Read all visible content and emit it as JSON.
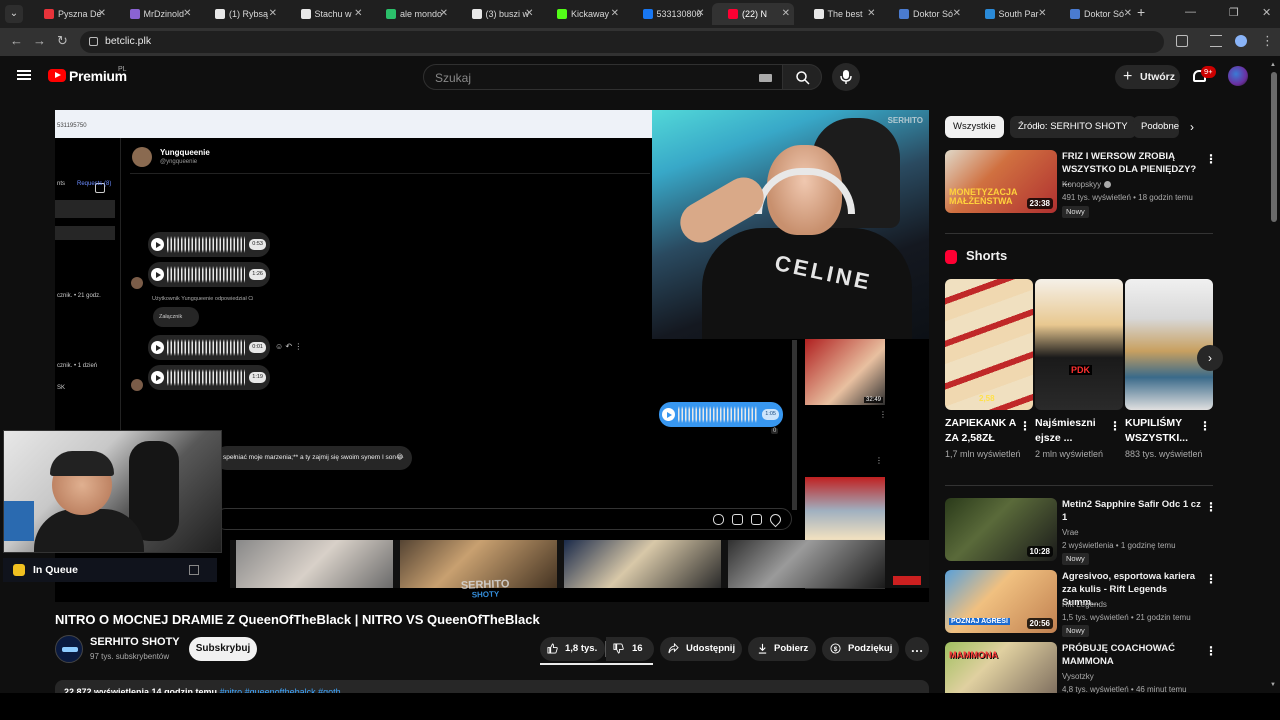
{
  "browser": {
    "tabs": [
      {
        "label": "Pyszna De",
        "color": "#e8333a"
      },
      {
        "label": "MrDzinold",
        "color": "#8a63d2"
      },
      {
        "label": "(1) Rybsą",
        "color": "#e8e8e8"
      },
      {
        "label": "Stachu w",
        "color": "#e8e8e8"
      },
      {
        "label": "ale mondo",
        "color": "#2bbf6a"
      },
      {
        "label": "(3) buszi w",
        "color": "#e8e8e8"
      },
      {
        "label": "Kickaway",
        "color": "#53fc18"
      },
      {
        "label": "533130800",
        "color": "#1877f2"
      },
      {
        "label": "(22) N",
        "color": "#ff0033"
      },
      {
        "label": "The best",
        "color": "#e8e8e8"
      },
      {
        "label": "Doktor Só",
        "color": "#4a7bd0"
      },
      {
        "label": "South Par",
        "color": "#2a8ad8"
      },
      {
        "label": "Doktor Só",
        "color": "#4a7bd0"
      }
    ],
    "url": "betclic.plk"
  },
  "header": {
    "brand": "Premium",
    "region": "PL",
    "search_placeholder": "Szukaj",
    "create_label": "Utwórz",
    "notif_count": "9+",
    "icons": [
      "menu-icon",
      "youtube-logo-icon",
      "keyboard-icon",
      "search-icon",
      "microphone-icon",
      "plus-icon",
      "bell-icon",
      "avatar"
    ]
  },
  "player": {
    "ig": {
      "topbar_text": "531195750",
      "requests": "Requests (8)",
      "left_rows": [
        "nts",
        "cznik. • 21 godz.",
        "cznik. • 1 dzień",
        "SK"
      ],
      "contact_name": "Yungqueenie",
      "contact_user": "@yngqueenie",
      "voice_durations": [
        "0:53",
        "1:26",
        "0:01",
        "1:19",
        "1:05"
      ],
      "note": "Użytkownik Yungqueenie odpowiedział Ci",
      "attachment": "Załącznik",
      "message": "spełniać moje marzenia;** a ty zajmij się swoim synem I son😂",
      "seen_count": "0"
    },
    "cam_watermark": "SERHITO",
    "cam_shirt_text": "CELINE",
    "thumb_duration": "32:49",
    "queue_label": "In Queue",
    "stream_watermark_1": "SERHITO",
    "stream_watermark_2": "SHOTY"
  },
  "video": {
    "title": "NITRO O MOCNEJ DRAMIE Z QueenOfTheBlack | NITRO VS QueenOfTheBlack",
    "channel": "SERHITO SHOTY",
    "subscribers": "97 tys. subskrybentów",
    "subscribe_label": "Subskrybuj",
    "likes": "1,8 tys.",
    "dislikes": "16",
    "share_label": "Udostępnij",
    "download_label": "Pobierz",
    "thanks_label": "Podziękuj",
    "more_label": "…",
    "views_date": "22 872 wyświetlenia  14 godzin temu",
    "hashtags": "#nitro #queenofthebalck #goth"
  },
  "sidebar": {
    "chips": [
      "Wszystkie",
      "Źródło: SERHITO SHOTY",
      "Podobne"
    ],
    "recs": [
      {
        "title": "FRIZ I WERSOW ZROBIĄ WSZYSTKO DLA PIENIĘDZY? ...",
        "channel": "Konopskyy",
        "meta": "491 tys. wyświetleń • 18 godzin temu",
        "badge": "Nowy",
        "duration": "23:38",
        "overlay": "MONETYZACJA MAŁŻEŃSTWA"
      },
      {
        "title": "Metin2 Sapphire  Safir  Odc 1 cz  1",
        "channel": "Vrae",
        "meta": "2 wyświetlenia • 1 godzinę temu",
        "badge": "Nowy",
        "duration": "10:28"
      },
      {
        "title": "Agresivoo, esportowa kariera zza kulis - Rift Legends Summ...",
        "channel": "Rift Legends",
        "meta": "1,5 tys. wyświetleń • 21 godzin temu",
        "badge": "Nowy",
        "duration": "20:56",
        "overlay": "POZNAJ AGRESI"
      },
      {
        "title": "PRÓBUJĘ COACHOWAĆ MAMMONA",
        "channel": "Vysotzky",
        "meta": "4,8 tys. wyświetleń • 46 minut temu",
        "overlay": "MAMMONA"
      }
    ],
    "shorts_label": "Shorts",
    "shorts": [
      {
        "title": "ZAPIEKANK A ZA 2,58ZŁ",
        "views": "1,7 mln wyświetleń",
        "tag": "2,58"
      },
      {
        "title": "Najśmieszni ejsze ...",
        "views": "2 mln wyświetleń",
        "tag": "PDK"
      },
      {
        "title": "KUPILIŚMY WSZYSTKI...",
        "views": "883 tys. wyświetleń"
      }
    ]
  }
}
